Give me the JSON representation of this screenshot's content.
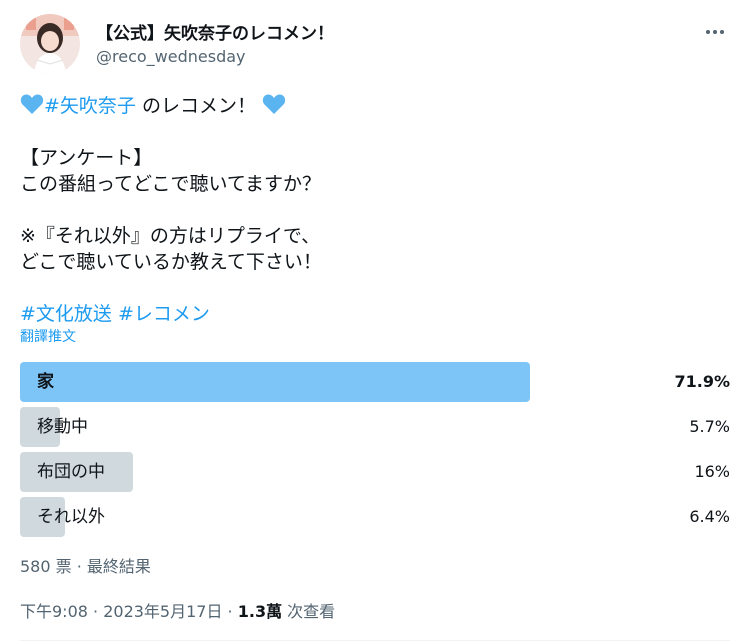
{
  "author": {
    "display_name": "【公式】矢吹奈子のレコメン！",
    "handle": "@reco_wednesday"
  },
  "tweet": {
    "line1_tag": "#矢吹奈子",
    "line1_text": " のレコメン！",
    "line2": "【アンケート】",
    "line3": "この番組ってどこで聴いてますか？",
    "line4": "※『それ以外』の方はリプライで、",
    "line5": "どこで聴いているか教えて下さい！",
    "hashtag1": "#文化放送",
    "hashtag2": "#レコメン"
  },
  "translate_label": "翻譯推文",
  "poll": {
    "options": [
      {
        "label": "家",
        "percent_text": "71.9%",
        "percent": 71.9,
        "winner": true
      },
      {
        "label": "移動中",
        "percent_text": "5.7%",
        "percent": 5.7,
        "winner": false
      },
      {
        "label": "布団の中",
        "percent_text": "16%",
        "percent": 16,
        "winner": false
      },
      {
        "label": "それ以外",
        "percent_text": "6.4%",
        "percent": 6.4,
        "winner": false
      }
    ],
    "votes": "580 票",
    "separator": " · ",
    "status": "最終結果"
  },
  "meta": {
    "time": "下午9:08",
    "separator": " · ",
    "date": "2023年5月17日",
    "views_count": "1.3萬",
    "views_label": " 次查看"
  },
  "colors": {
    "accent": "#1d9bf0",
    "winner_bar": "#7dc4f7",
    "other_bar": "#cfd9de",
    "heart": "#5ab4f0"
  }
}
